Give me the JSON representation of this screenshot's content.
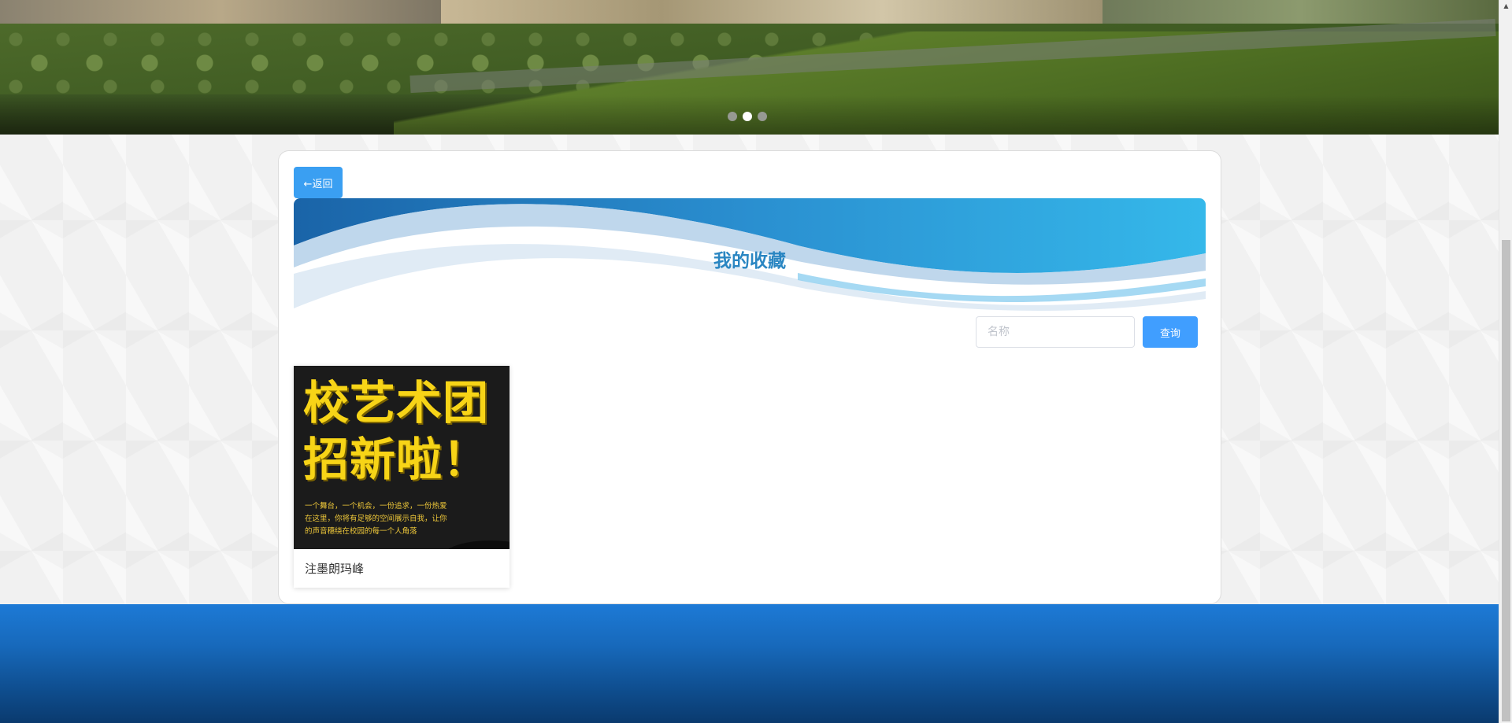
{
  "banner": {
    "slides": [
      "slide-1",
      "slide-2",
      "slide-3"
    ],
    "active_slide": 2
  },
  "nav": {
    "back_label": "←返回"
  },
  "hero": {
    "title": "我的收藏"
  },
  "search": {
    "placeholder": "名称",
    "button_label": "查询"
  },
  "favorites": [
    {
      "title": "注墨朗玛峰",
      "poster": {
        "headline_line1": "校艺术团",
        "headline_line2": "招新啦！",
        "text_line1": "一个舞台，一个机会，一份追求，一份热爱",
        "text_line2": "在这里，你将有足够的空间展示自我，让你",
        "text_line3": "的声音穗绕在校园的每一个人角落"
      }
    }
  ],
  "colors": {
    "accent": "#409eff",
    "title": "#2a86c2",
    "footer": "#1769bb"
  }
}
